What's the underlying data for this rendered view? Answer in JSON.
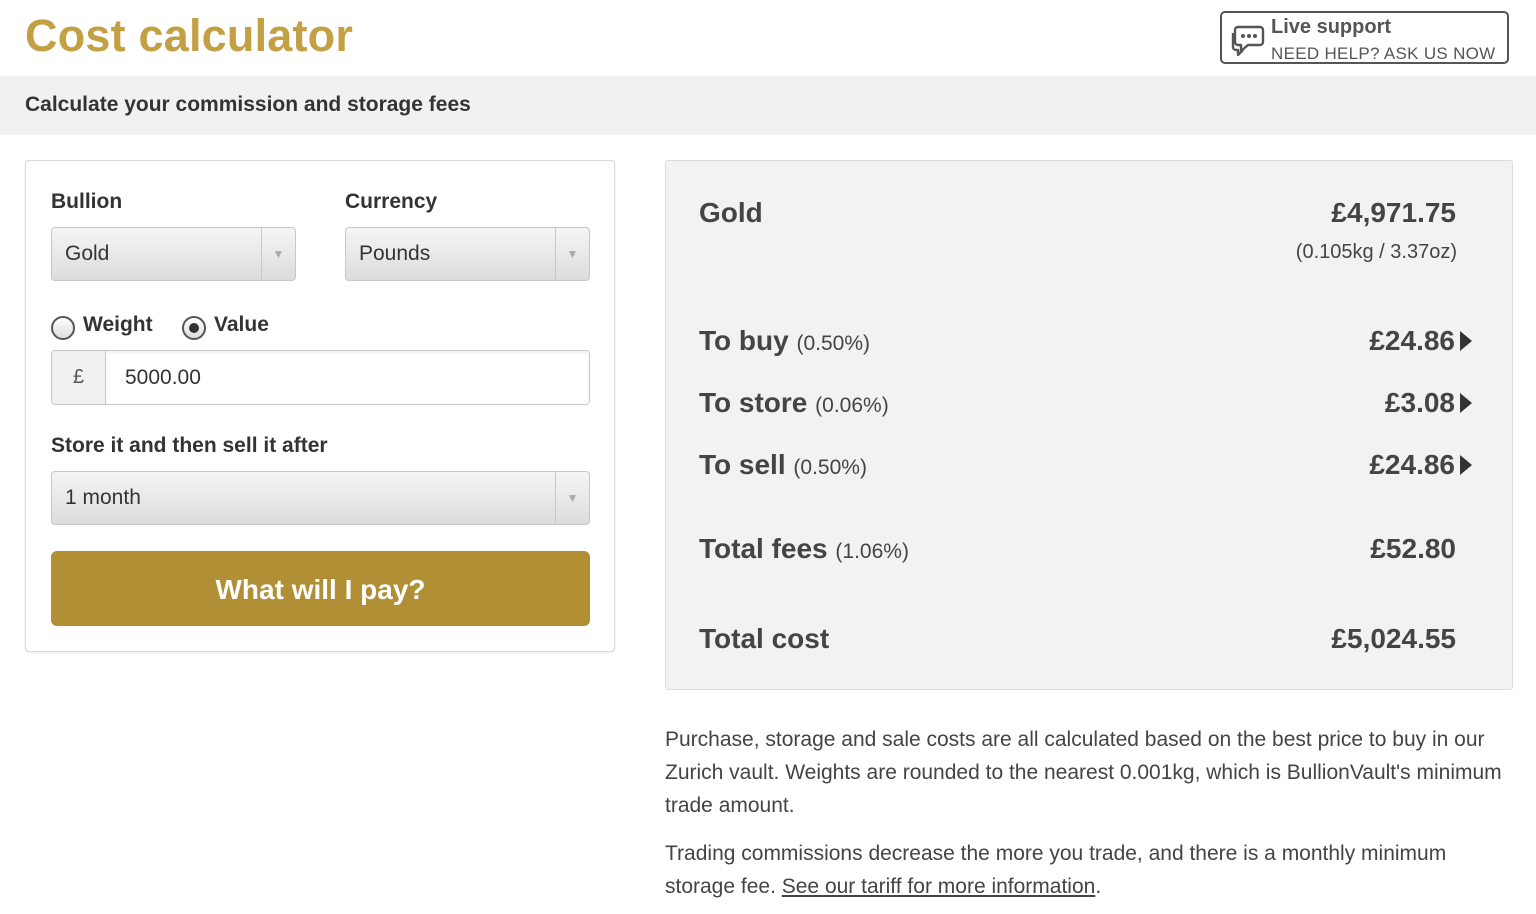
{
  "header": {
    "title": "Cost calculator",
    "support": {
      "title": "Live support",
      "subtitle": "NEED HELP? ASK US NOW",
      "icon": "chat-bubbles-icon"
    }
  },
  "subtitle": "Calculate your commission and storage fees",
  "form": {
    "bullion_label": "Bullion",
    "bullion_value": "Gold",
    "currency_label": "Currency",
    "currency_value": "Pounds",
    "mode_options": [
      "Weight",
      "Value"
    ],
    "mode_selected": "Value",
    "amount_prefix": "£",
    "amount_value": "5000.00",
    "period_label": "Store it and then sell it after",
    "period_value": "1 month",
    "submit_label": "What will I pay?"
  },
  "results": {
    "metal_label": "Gold",
    "metal_value": "£4,971.75",
    "metal_weight": "(0.105kg / 3.37oz)",
    "fees": [
      {
        "label": "To buy",
        "pct": "(0.50%)",
        "value": "£24.86"
      },
      {
        "label": "To store",
        "pct": "(0.06%)",
        "value": "£3.08"
      },
      {
        "label": "To sell",
        "pct": "(0.50%)",
        "value": "£24.86"
      }
    ],
    "total_fees_label": "Total fees",
    "total_fees_pct": "(1.06%)",
    "total_fees_value": "£52.80",
    "total_cost_label": "Total cost",
    "total_cost_value": "£5,024.55"
  },
  "notes": {
    "paragraph1": "Purchase, storage and sale costs are all calculated based on the best price to buy in our Zurich vault. Weights are rounded to the nearest 0.001kg, which is BullionVault's minimum trade amount.",
    "paragraph2_text": "Trading commissions decrease the more you trade, and there is a monthly minimum storage fee.",
    "paragraph2_link": "See our tariff for more information",
    "paragraph2_end": "."
  },
  "colors": {
    "title_gold": "#c3a044",
    "button_gold": "#b08f35",
    "panel_bg": "#f2f2f2",
    "subtitle_bar_bg": "#f1f1f1"
  }
}
